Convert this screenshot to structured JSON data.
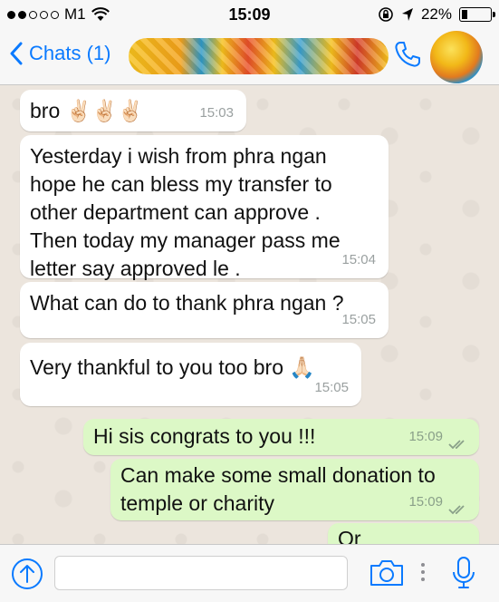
{
  "status_bar": {
    "carrier": "M1",
    "time": "15:09",
    "battery": "22%",
    "battery_level": 0.22
  },
  "nav": {
    "back_label": "Chats (1)"
  },
  "messages": [
    {
      "direction": "in",
      "text_lines": [
        "bro ✌🏻✌🏻✌🏻"
      ],
      "time": "15:03"
    },
    {
      "direction": "in",
      "text_lines": [
        "Yesterday i wish from phra ngan",
        "hope he can bless my transfer to",
        "other department can approve .",
        "Then today my manager pass me",
        "letter say approved le ."
      ],
      "time": "15:04"
    },
    {
      "direction": "in",
      "text_lines": [
        "What can do to thank phra ngan ?"
      ],
      "time": "15:05"
    },
    {
      "direction": "in",
      "text_lines": [
        "Very thankful to you too bro 🙏🏻"
      ],
      "time": "15:05"
    },
    {
      "direction": "out",
      "text_lines": [
        "Hi sis congrats to you !!!"
      ],
      "time": "15:09"
    },
    {
      "direction": "out",
      "text_lines": [
        "Can make some small donation to",
        "temple or charity"
      ],
      "time": "15:09"
    },
    {
      "direction": "out",
      "text_lines": [
        "Or"
      ],
      "time": ""
    }
  ],
  "colors": {
    "accent": "#0a7aff",
    "incoming_bubble": "#ffffff",
    "outgoing_bubble": "#dcf8c6",
    "chat_background": "#ece5dd"
  },
  "icons": {
    "back": "chevron-left-icon",
    "call": "phone-icon",
    "upload": "arrow-up-circle-icon",
    "camera": "camera-icon",
    "mic": "microphone-icon"
  }
}
